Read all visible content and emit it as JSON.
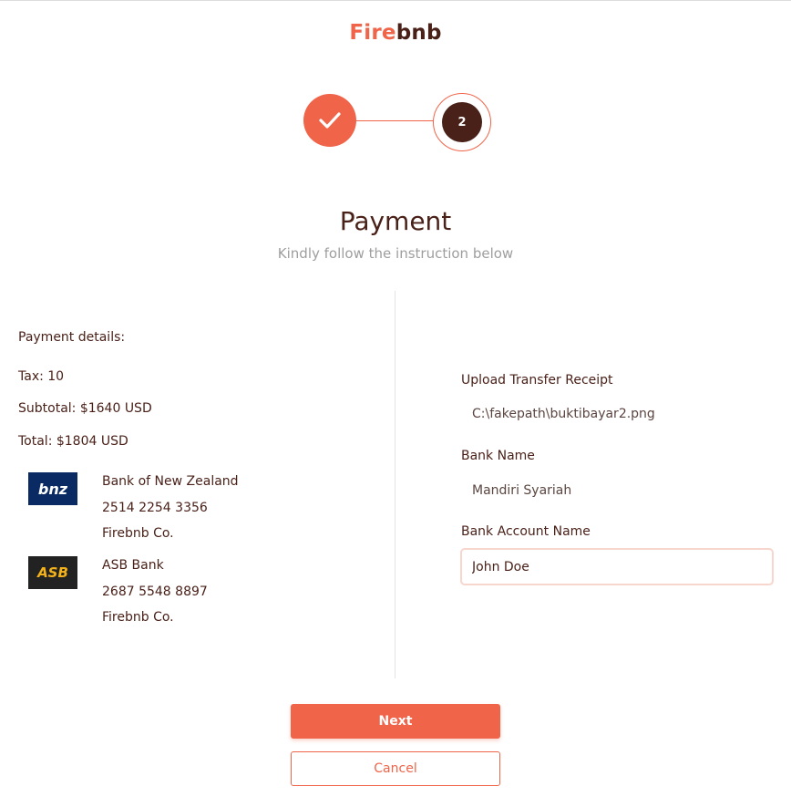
{
  "brand": {
    "part1": "Fire",
    "part2": "bnb",
    "accent": "#f0654a",
    "dark": "#4a2119"
  },
  "stepper": {
    "step1_icon": "check-icon",
    "step2_label": "2"
  },
  "header": {
    "title": "Payment",
    "subtitle": "Kindly follow the instruction below"
  },
  "details": {
    "heading": "Payment details:",
    "tax": "Tax: 10",
    "subtotal": "Subtotal: $1640 USD",
    "total": "Total: $1804 USD"
  },
  "banks": [
    {
      "logo_text": "bnz",
      "name": "Bank of New Zealand",
      "number": "2514 2254 3356",
      "holder": "Firebnb Co."
    },
    {
      "logo_text": "ASB",
      "name": "ASB Bank",
      "number": "2687 5548 8897",
      "holder": "Firebnb Co."
    }
  ],
  "form": {
    "receipt_label": "Upload Transfer Receipt",
    "receipt_value": "C:\\fakepath\\buktibayar2.png",
    "bank_name_label": "Bank Name",
    "bank_name_value": "Mandiri Syariah",
    "account_name_label": "Bank Account Name",
    "account_name_value": "John Doe"
  },
  "buttons": {
    "next": "Next",
    "cancel": "Cancel"
  }
}
